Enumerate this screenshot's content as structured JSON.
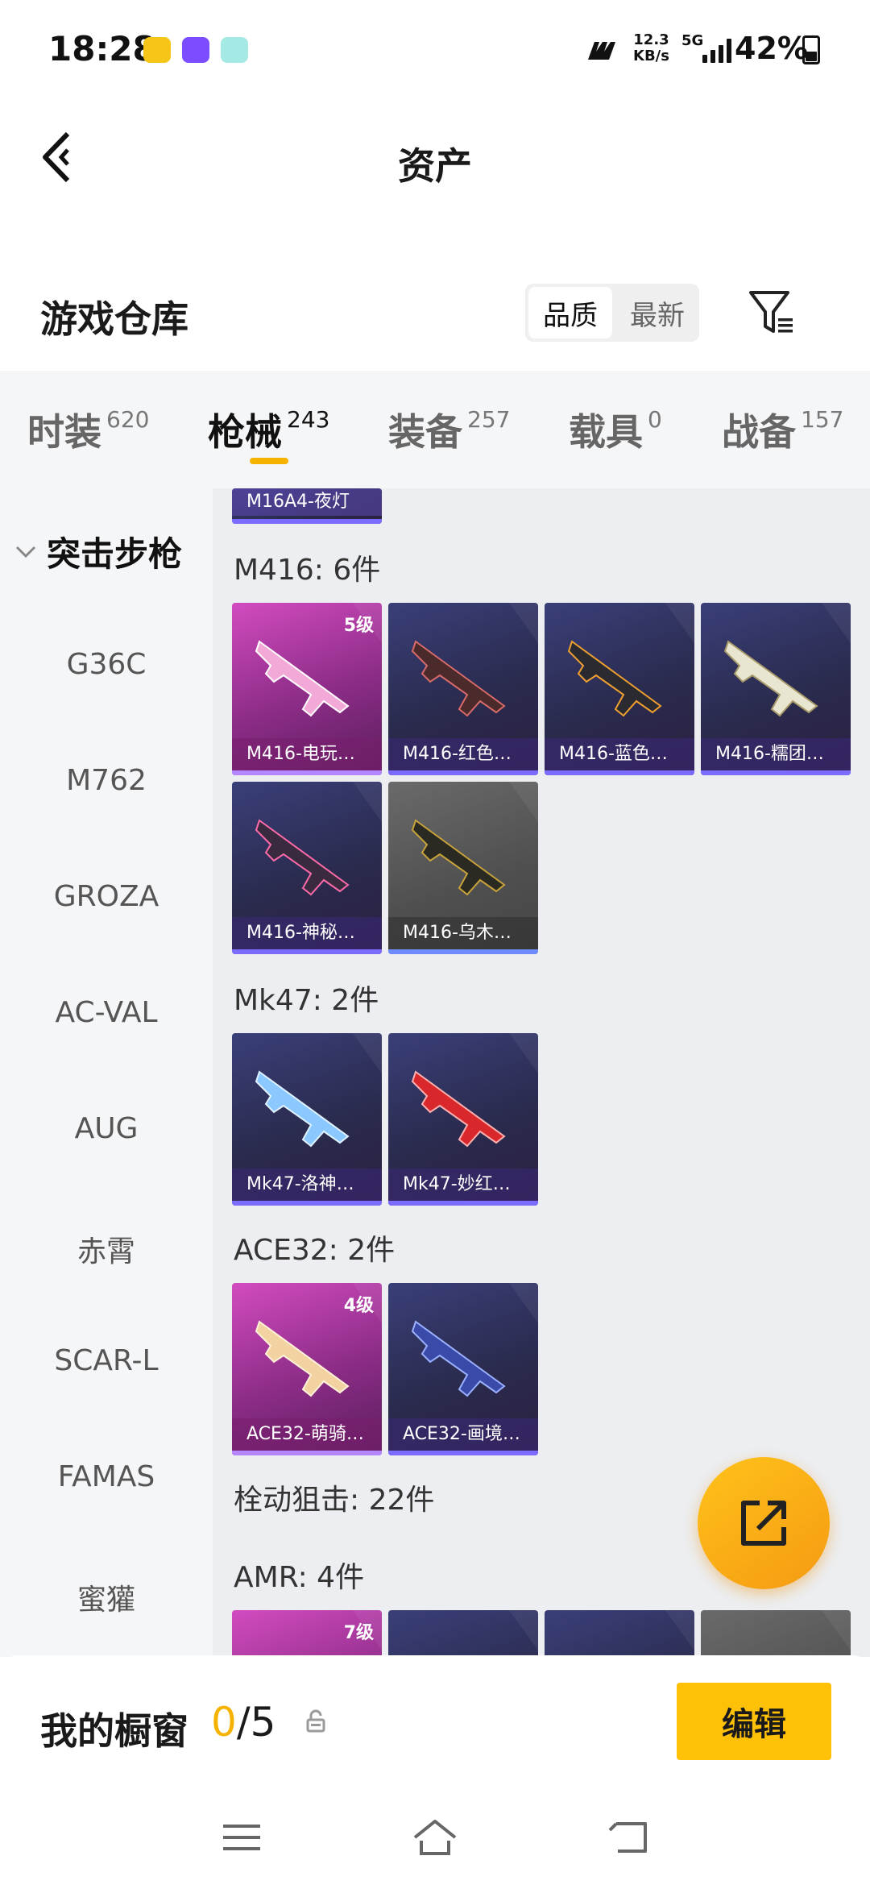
{
  "status_bar": {
    "time": "18:28",
    "net_speed_value": "12.3",
    "net_speed_unit": "KB/s",
    "network": "5G",
    "battery": "42%",
    "colors": {
      "notif1": "#f5c518",
      "notif2": "#7b4dff",
      "notif3": "#7fe0d8"
    }
  },
  "header": {
    "title": "资产",
    "back_icon": "chevron-left-icon"
  },
  "warehouse": {
    "title": "游戏仓库",
    "sort_options": [
      "品质",
      "最新"
    ],
    "sort_selected": "品质",
    "filter_icon": "filter-icon"
  },
  "tabs": [
    {
      "label": "时装",
      "count": "620"
    },
    {
      "label": "枪械",
      "count": "243",
      "active": true
    },
    {
      "label": "装备",
      "count": "257"
    },
    {
      "label": "载具",
      "count": "0"
    },
    {
      "label": "战备",
      "count": "157"
    }
  ],
  "sidebar": {
    "group": "突击步枪",
    "items": [
      "G36C",
      "M762",
      "GROZA",
      "AC-VAL",
      "AUG",
      "赤霄",
      "SCAR-L",
      "FAMAS",
      "蜜獾"
    ]
  },
  "content": {
    "partial_top_item": "M16A4-夜灯",
    "groups": [
      {
        "heading": "M416: 6件",
        "items": [
          {
            "name": "M416-电玩…",
            "level": "5级",
            "tier": "pink"
          },
          {
            "name": "M416-红色…",
            "tier": "purple"
          },
          {
            "name": "M416-蓝色…",
            "tier": "purple"
          },
          {
            "name": "M416-糯团…",
            "tier": "purple"
          },
          {
            "name": "M416-神秘…",
            "tier": "purple"
          },
          {
            "name": "M416-乌木…",
            "tier": "grey"
          }
        ]
      },
      {
        "heading": "Mk47: 2件",
        "items": [
          {
            "name": "Mk47-洛神…",
            "tier": "purple"
          },
          {
            "name": "Mk47-妙红…",
            "tier": "purple"
          }
        ]
      },
      {
        "heading": "ACE32: 2件",
        "items": [
          {
            "name": "ACE32-萌骑…",
            "level": "4级",
            "tier": "pink"
          },
          {
            "name": "ACE32-画境…",
            "tier": "purple"
          }
        ]
      }
    ],
    "subcategory_heading": "栓动狙击: 22件",
    "amr_heading": "AMR: 4件",
    "amr_first_level": "7级"
  },
  "showcase": {
    "label": "我的橱窗",
    "used": "0",
    "total": "/5",
    "edit_label": "编辑"
  }
}
